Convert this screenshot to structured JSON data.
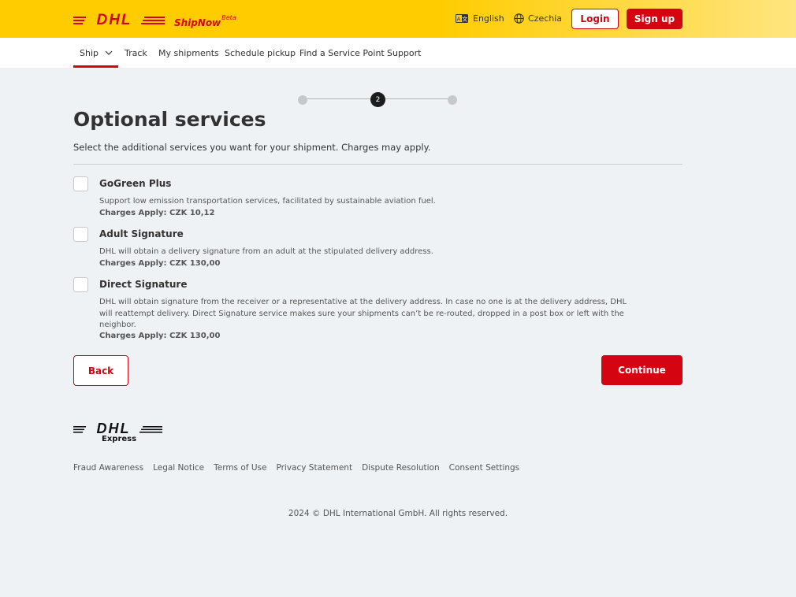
{
  "header": {
    "brand_sub": "ShipNow",
    "beta": "Beta",
    "language": "English",
    "country": "Czechia",
    "login": "Login",
    "signup": "Sign up"
  },
  "nav": {
    "items": [
      "Ship",
      "Track",
      "My shipments",
      "Schedule pickup",
      "Find a Service Point",
      "Support"
    ],
    "active": "Ship"
  },
  "stepper": {
    "current": "2",
    "total_steps": 3
  },
  "page": {
    "title": "Optional services",
    "subtitle": "Select the additional services you want for your shipment. Charges may apply."
  },
  "services": [
    {
      "title": "GoGreen Plus",
      "description": "Support low emission transportation services, facilitated by sustainable aviation fuel.",
      "charge": "Charges Apply: CZK 10,12",
      "checked": false
    },
    {
      "title": "Adult Signature",
      "description": "DHL will obtain a delivery signature from an adult at the stipulated delivery address.",
      "charge": "Charges Apply: CZK 130,00",
      "checked": false
    },
    {
      "title": "Direct Signature",
      "description": "DHL will obtain signature from the receiver or a representative at the delivery address. In case no one is at the delivery address, DHL will reattempt delivery. Direct Signature service makes sure your shipments can’t be re-routed, dropped in a post box or left with the neighbor.",
      "charge": "Charges Apply: CZK 130,00",
      "checked": false
    }
  ],
  "actions": {
    "back": "Back",
    "continue": "Continue"
  },
  "footer": {
    "express": "Express",
    "links": [
      "Fraud Awareness",
      "Legal Notice",
      "Terms of Use",
      "Privacy Statement",
      "Dispute Resolution",
      "Consent Settings"
    ],
    "copyright": "2024 © DHL International GmbH. All rights reserved."
  },
  "colors": {
    "brand_yellow": "#ffcc00",
    "brand_red": "#d40511",
    "background": "#eff2f5"
  }
}
